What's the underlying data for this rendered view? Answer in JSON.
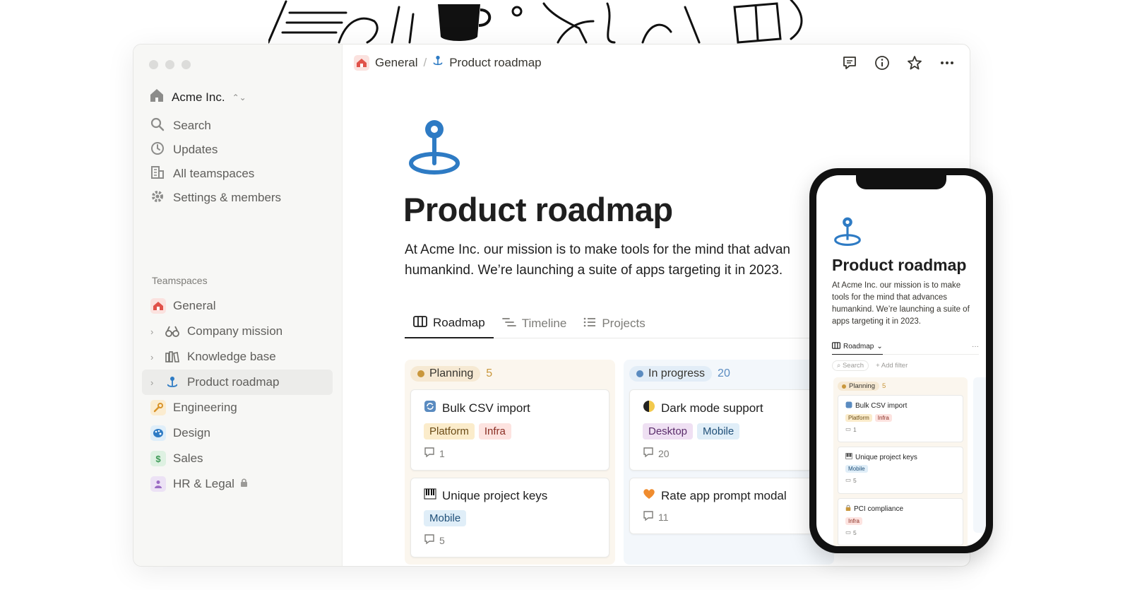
{
  "sidebar": {
    "workspace": "Acme Inc.",
    "nav": [
      {
        "label": "Search",
        "icon": "search-icon"
      },
      {
        "label": "Updates",
        "icon": "clock-icon"
      },
      {
        "label": "All teamspaces",
        "icon": "building-icon"
      },
      {
        "label": "Settings & members",
        "icon": "gear-icon"
      }
    ],
    "section_label": "Teamspaces",
    "teamspaces": [
      {
        "label": "General",
        "icon": "house-icon"
      },
      {
        "label": "Company mission",
        "icon": "binoculars-icon"
      },
      {
        "label": "Knowledge base",
        "icon": "books-icon"
      },
      {
        "label": "Product roadmap",
        "icon": "pin-icon"
      },
      {
        "label": "Engineering",
        "icon": "wrench-icon"
      },
      {
        "label": "Design",
        "icon": "palette-icon"
      },
      {
        "label": "Sales",
        "icon": "dollar-icon"
      },
      {
        "label": "HR & Legal",
        "icon": "person-icon"
      }
    ]
  },
  "breadcrumb": {
    "parent": "General",
    "sep": "/",
    "current": "Product roadmap"
  },
  "page": {
    "title": "Product roadmap",
    "description": "At Acme Inc. our mission is to make tools for the mind that advan humankind. We’re launching a suite of apps targeting it in 2023."
  },
  "tabs": [
    "Roadmap",
    "Timeline",
    "Projects"
  ],
  "board": {
    "planning": {
      "label": "Planning",
      "count": "5",
      "cards": [
        {
          "title": "Bulk CSV import",
          "tags": [
            "Platform",
            "Infra"
          ],
          "comments": "1"
        },
        {
          "title": "Unique project keys",
          "tags": [
            "Mobile"
          ],
          "comments": "5"
        }
      ]
    },
    "in_progress": {
      "label": "In progress",
      "count": "20",
      "cards": [
        {
          "title": "Dark mode support",
          "tags": [
            "Desktop",
            "Mobile"
          ],
          "comments": "20"
        },
        {
          "title": "Rate app prompt modal",
          "tags": [],
          "comments": "11"
        }
      ]
    }
  },
  "mobile": {
    "title": "Product roadmap",
    "description": "At Acme Inc. our mission is to make tools for the mind that advances humankind. We’re launching a suite of apps targeting it in 2023.",
    "tab": "Roadmap",
    "more": "···",
    "search": "Search",
    "add_filter": "+ Add filter",
    "planning_label": "Planning",
    "planning_count": "5",
    "cards": [
      {
        "title": "Bulk CSV import",
        "tags": [
          "Platform",
          "Infra"
        ],
        "comments": "1"
      },
      {
        "title": "Unique project keys",
        "tags": [
          "Mobile"
        ],
        "comments": "5"
      },
      {
        "title": "PCI compliance",
        "tags": [
          "Infra"
        ],
        "comments": "5"
      }
    ]
  },
  "colors": {
    "accent_blue": "#2e7bc4",
    "planning_dot": "#c9973c",
    "in_progress_dot": "#5a8bc0",
    "tag_platform": "#fbeccb",
    "tag_infra": "#fde3e0",
    "tag_mobile": "#e0eef8",
    "tag_desktop": "#efe0f3"
  }
}
